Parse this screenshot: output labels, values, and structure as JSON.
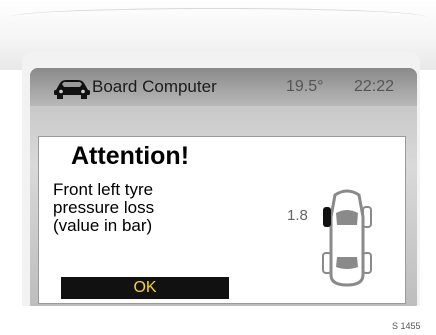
{
  "header": {
    "title": "Board Computer",
    "temperature": "19.5°",
    "time": "22:22",
    "icon": "car-icon"
  },
  "dialog": {
    "heading": "Attention!",
    "message_lines": [
      "Front left tyre",
      "pressure loss",
      "(value in bar)"
    ],
    "pressure_value": "1.8",
    "ok_label": "OK",
    "icon": "car-top-view-icon",
    "affected_tyre": "front-left"
  },
  "colors": {
    "button_background": "#111111",
    "button_text": "#f5d90a",
    "screen_gray": "#bdbdbd"
  },
  "footer": {
    "reference": "S 1455"
  }
}
